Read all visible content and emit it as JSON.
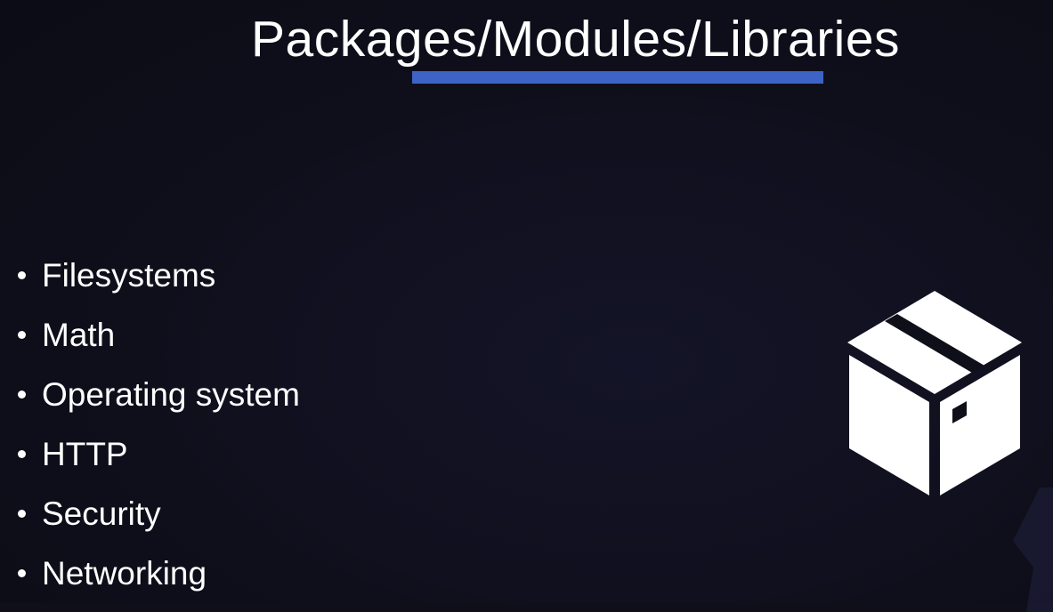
{
  "slide": {
    "title": "Packages/Modules/Libraries",
    "bullets": [
      {
        "label": "Filesystems"
      },
      {
        "label": "Math"
      },
      {
        "label": "Operating system"
      },
      {
        "label": "HTTP"
      },
      {
        "label": "Security"
      },
      {
        "label": "Networking"
      }
    ],
    "icon": "package-box-icon"
  },
  "colors": {
    "background": "#0f0f1a",
    "text": "#ffffff",
    "accent_underline": "#3d63c6"
  }
}
